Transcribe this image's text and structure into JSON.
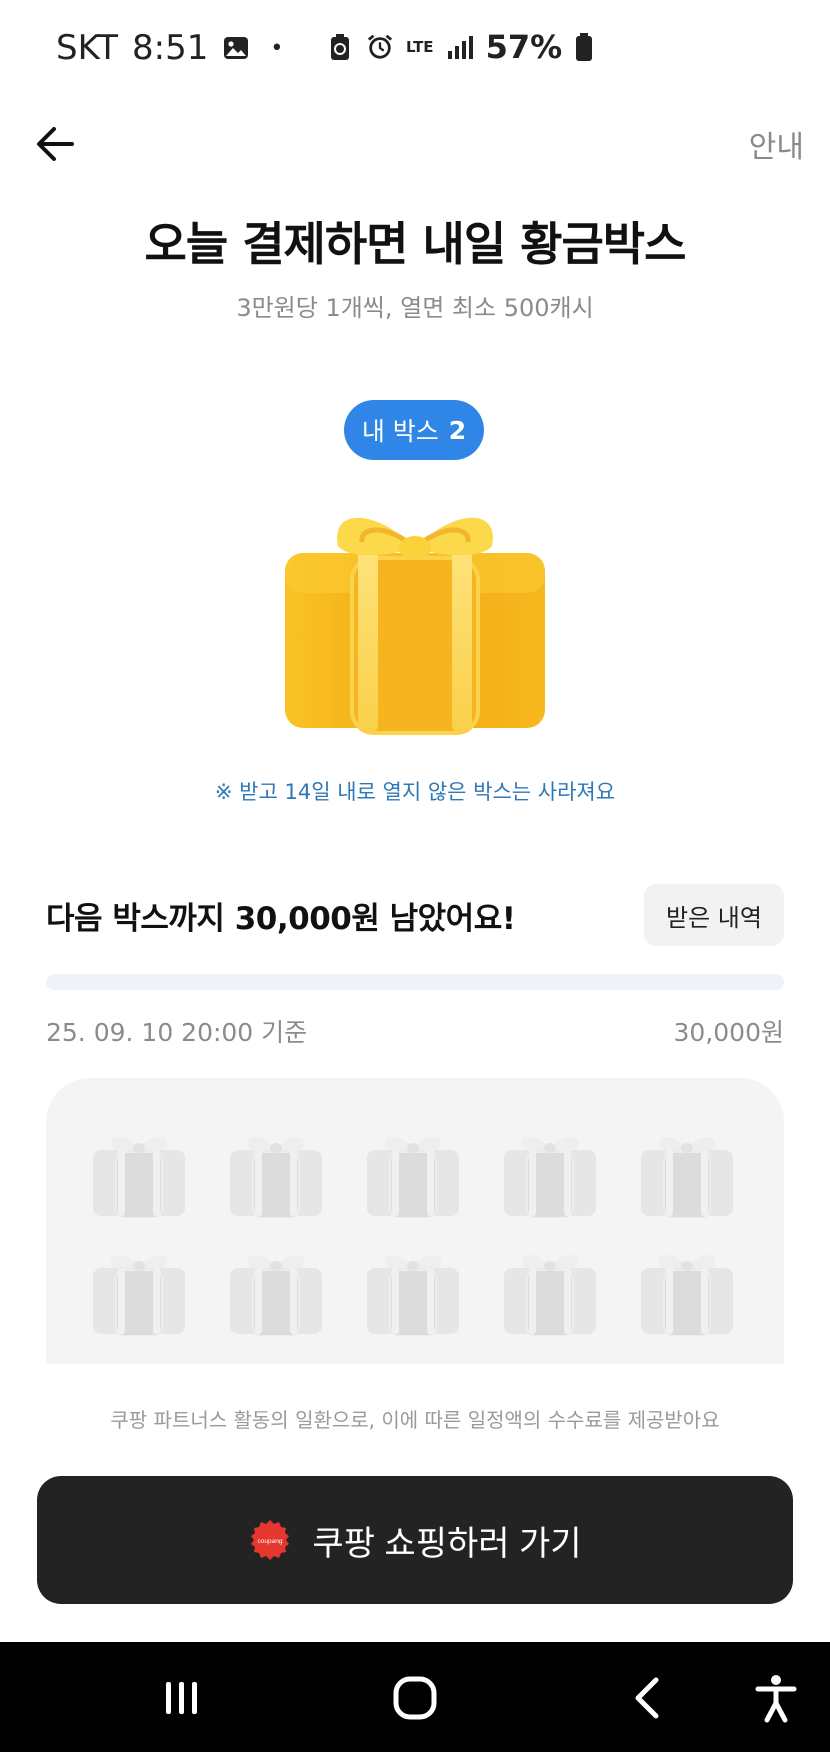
{
  "status_bar": {
    "carrier": "SKT",
    "time": "8:51",
    "dot": "•",
    "lte": "LTE",
    "battery": "57%"
  },
  "header": {
    "guide": "안내"
  },
  "title": "오늘 결제하면 내일 황금박스",
  "subtitle": "3만원당 1개씩, 열면 최소 500캐시",
  "my_box": {
    "label": "내 박스",
    "count": "2"
  },
  "notice": "※ 받고 14일 내로 열지 않은 박스는 사라져요",
  "progress": {
    "message": "다음 박스까지 30,000원 남았어요!",
    "history_button": "받은 내역",
    "fill_fraction": 0,
    "date": "25. 09. 10 20:00 기준",
    "goal": "30,000원"
  },
  "box_grid": {
    "rows": 2,
    "cols": 5
  },
  "partner_note": "쿠팡 파트너스 활동의 일환으로, 이에 따른 일정액의 수수료를 제공받아요",
  "shop_button": {
    "logo_text": "coupang",
    "label": "쿠팡 쇼핑하러 가기"
  },
  "colors": {
    "accent_blue": "#2f86e6",
    "notice_blue": "#2f78b8",
    "gold": "#f7b81a",
    "button_dark": "#232323"
  },
  "icons": [
    "back-arrow-icon",
    "gallery-icon",
    "battery-saver-icon",
    "alarm-icon",
    "signal-icon",
    "battery-icon",
    "gift-box-icon",
    "coupang-logo-icon",
    "recents-icon",
    "home-icon",
    "back-nav-icon",
    "accessibility-icon"
  ]
}
